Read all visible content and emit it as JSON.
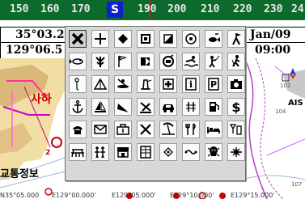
{
  "compass": {
    "ticks": [
      "150",
      "160",
      "170",
      "190",
      "200",
      "210",
      "220",
      "230",
      "24"
    ],
    "heading_marker": "S"
  },
  "nav": {
    "latitude": "35°03.2",
    "longitude": "129°06.5",
    "date": "Jan/09",
    "time": "09:00"
  },
  "chart": {
    "label_ais": "AIS",
    "label_korean_1": "사하",
    "label_korean_2": "교통정보",
    "depth_2": "2",
    "depth_107": "107",
    "depth_102": "102",
    "depth_104": "104"
  },
  "bottom_coords": [
    "N35°05.000",
    "E129°00.000'",
    "E129°05.000'",
    "E129°10.000'",
    "E129°15.000'"
  ],
  "icon_palette": {
    "selected_index": 0,
    "icons": [
      "x-mark-icon",
      "cross-icon",
      "diamond-icon",
      "square-icon",
      "half-square-icon",
      "circle-dot-icon",
      "fish-icon",
      "triangle-flag-icon",
      "big-fish-icon",
      "coral-icon",
      "flag-icon",
      "pennant-icon",
      "diver-icon",
      "swimmer-icon",
      "fisherman-icon",
      "hiker-icon",
      "buoy-icon",
      "tent-icon",
      "kayak-icon",
      "lighthouse-icon",
      "first-aid-icon",
      "info-icon",
      "parking-icon",
      "camera-icon",
      "anchor-icon",
      "sailboat-icon",
      "jetski-icon",
      "skier-icon",
      "car-icon",
      "waves-icon",
      "fuel-icon",
      "dollar-icon",
      "phone-icon",
      "mail-icon",
      "tools-box-icon",
      "wrench-icon",
      "beach-icon",
      "restaurant-icon",
      "bed-icon",
      "cocktail-icon",
      "picnic-table-icon",
      "family-icon",
      "shop-icon",
      "building-icon",
      "arrow-diamond-icon",
      "binoculars-icon",
      "skull-icon",
      "wreck-icon"
    ]
  }
}
